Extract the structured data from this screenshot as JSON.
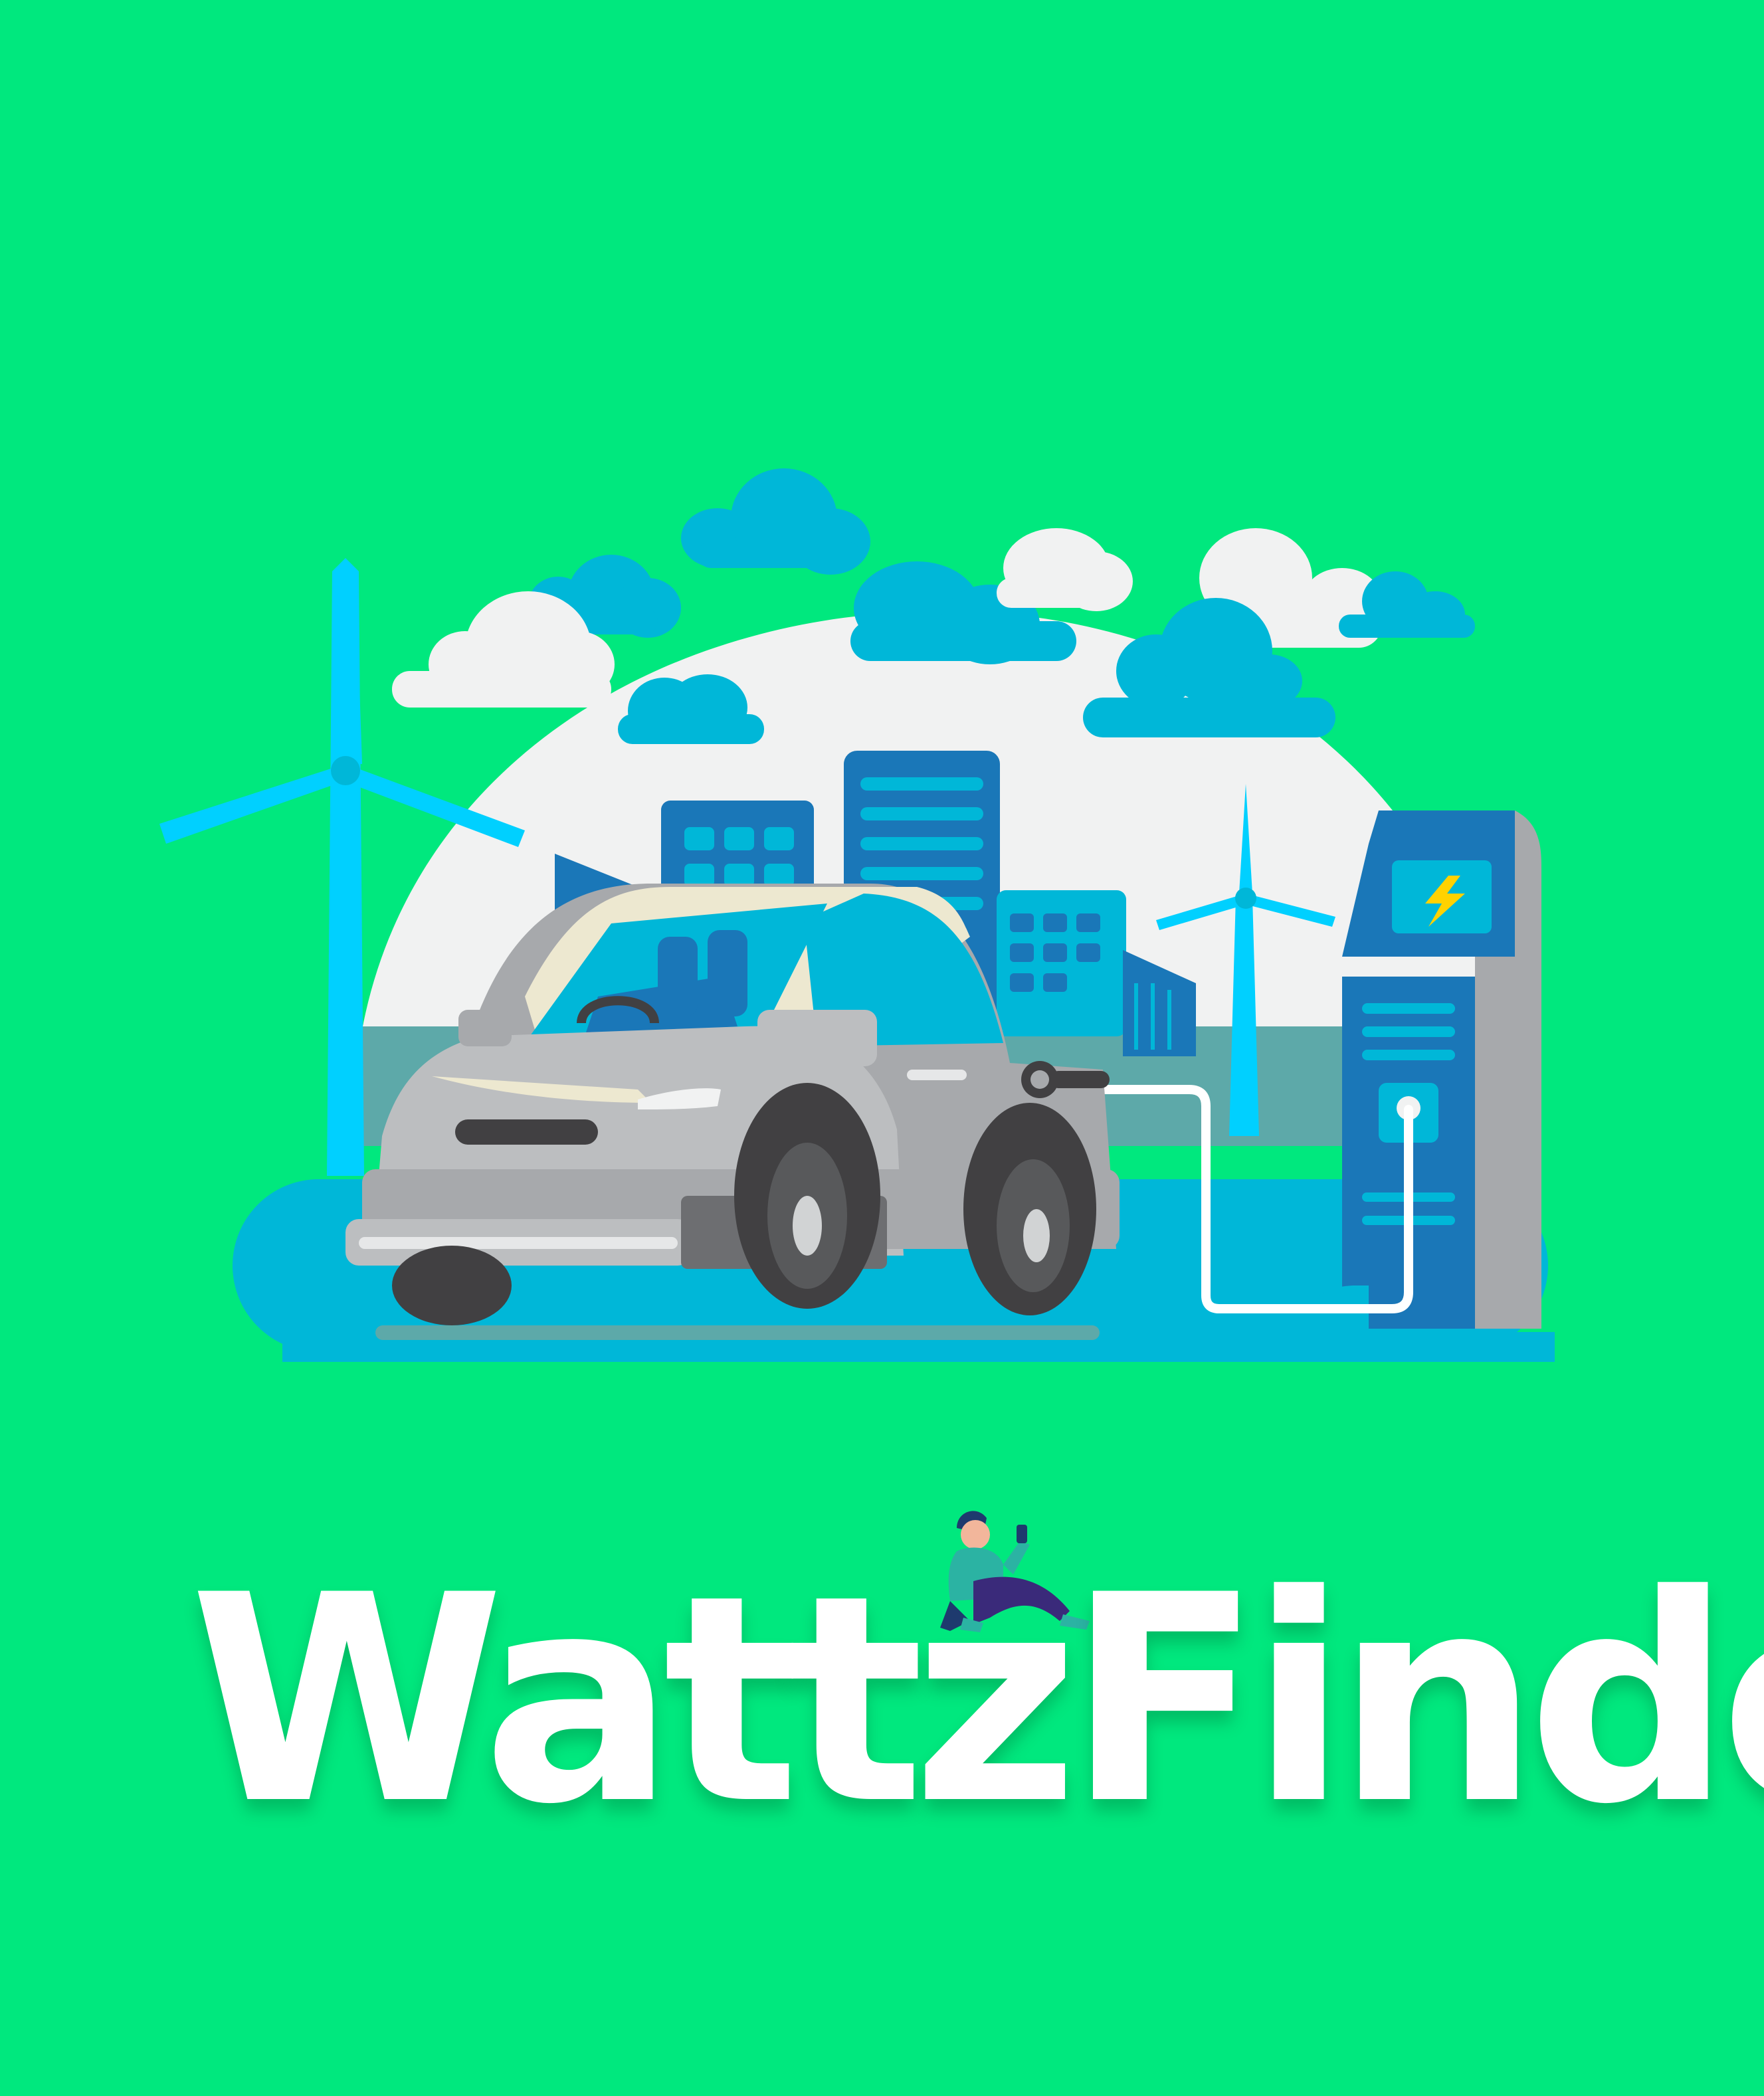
{
  "app": {
    "name": "WattzFinder"
  },
  "colors": {
    "background": "#00E87E",
    "accent_blue": "#00B7D8",
    "deep_blue": "#1A77B8",
    "cloud_white": "#F1F2F2",
    "car_gray": "#A7A9AC",
    "lightning": "#FFD200"
  },
  "icons": {
    "hero": "ev-charging-city-illustration",
    "bolt": "lightning-bolt-icon",
    "person": "seated-person-with-phone"
  }
}
